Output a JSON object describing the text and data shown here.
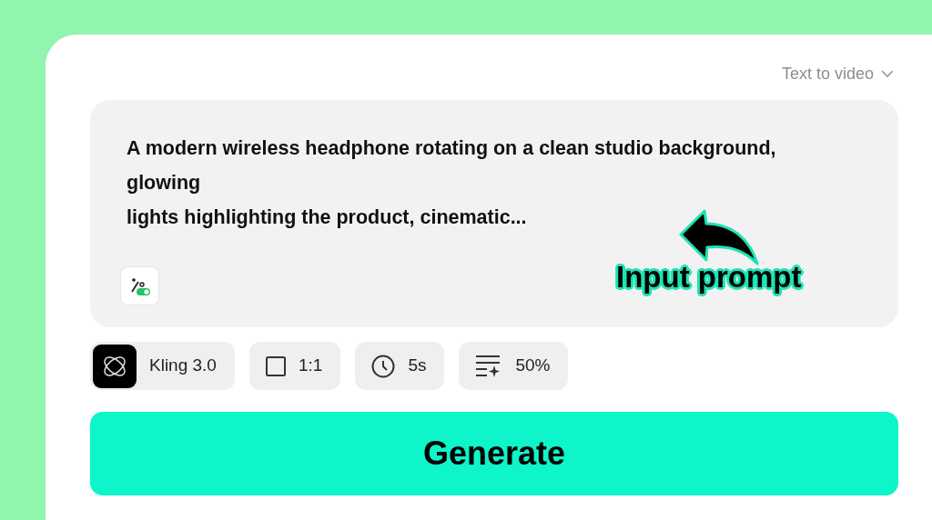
{
  "mode_selector": {
    "label": "Text to video"
  },
  "prompt": {
    "value": "A modern wireless headphone rotating on a clean studio background, glowing lights highlighting the product, cinematic..."
  },
  "annotation": {
    "label": "Input prompt"
  },
  "options": [
    {
      "kind": "model",
      "label": "Kling 3.0"
    },
    {
      "kind": "ratio",
      "label": "1:1"
    },
    {
      "kind": "duration",
      "label": "5s"
    },
    {
      "kind": "strength",
      "label": "50%"
    }
  ],
  "generate_button": {
    "label": "Generate"
  }
}
